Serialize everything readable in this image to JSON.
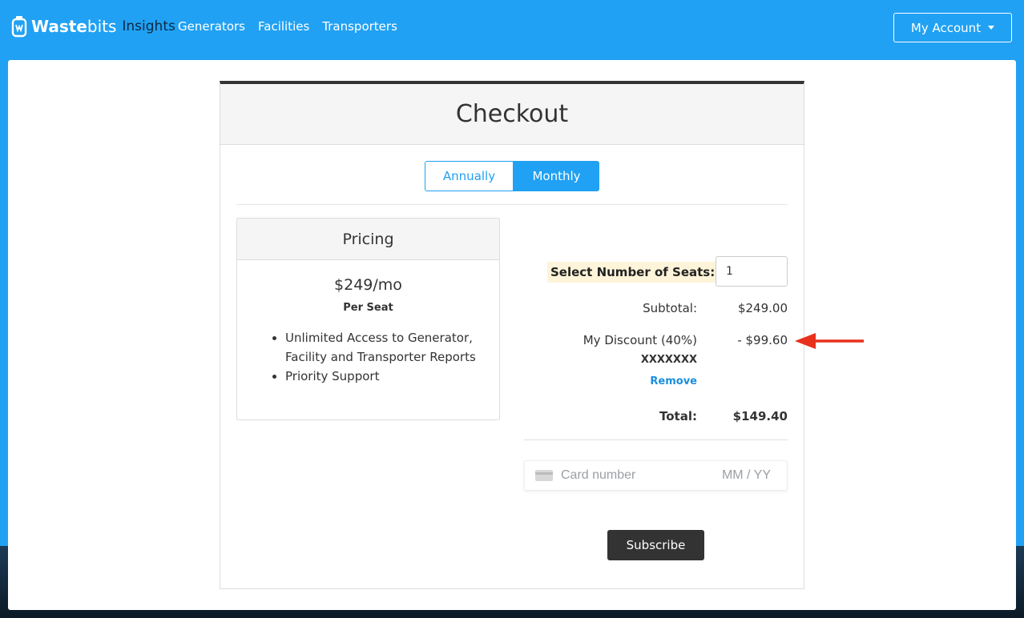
{
  "nav": {
    "brand_bold": "Waste",
    "brand_light": "bits",
    "brand_sub": "Insights",
    "links": [
      "Generators",
      "Facilities",
      "Transporters"
    ],
    "account_label": "My Account"
  },
  "checkout": {
    "title": "Checkout",
    "billing_toggle": {
      "options": [
        "Annually",
        "Monthly"
      ],
      "selected": "Monthly"
    },
    "pricing": {
      "heading": "Pricing",
      "price": "$249/mo",
      "unit": "Per Seat",
      "features": [
        "Unlimited Access to Generator, Facility and Transporter Reports",
        "Priority Support"
      ]
    },
    "summary": {
      "seats_label": "Select Number of Seats:",
      "seats_value": "1",
      "subtotal_label": "Subtotal:",
      "subtotal_value": "$249.00",
      "discount_label": "My Discount (40%)",
      "discount_value": "- $99.60",
      "discount_code": "XXXXXXX",
      "remove_label": "Remove",
      "total_label": "Total:",
      "total_value": "$149.40"
    },
    "payment": {
      "card_placeholder": "Card number",
      "expiry_placeholder": "MM / YY"
    },
    "subscribe_label": "Subscribe"
  },
  "colors": {
    "primary": "#21a1f3",
    "dark_button": "#333333",
    "annotation_arrow": "#e8301c"
  }
}
